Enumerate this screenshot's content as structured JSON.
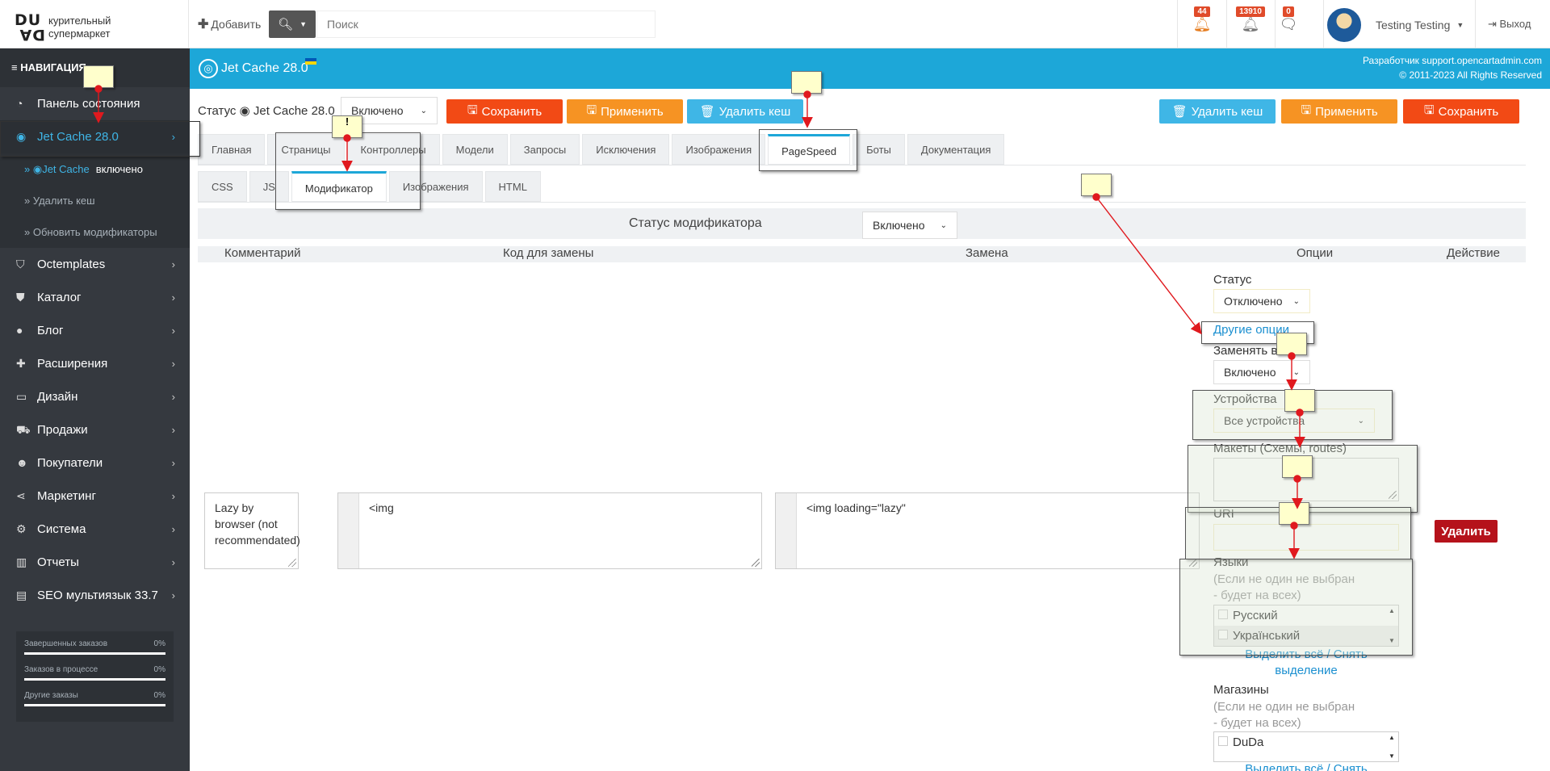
{
  "header": {
    "logo_mark_top": "DU",
    "logo_mark_bottom": "DA",
    "logo_line1": "курительный",
    "logo_line2": "супермаркет",
    "add_label": "Добавить",
    "search_placeholder": "Поиск",
    "notifications": [
      {
        "icon": "bell-icon",
        "count": "44",
        "color": "#e67e22"
      },
      {
        "icon": "bell-icon",
        "count": "13910",
        "color": "#777777"
      },
      {
        "icon": "comment-icon",
        "count": "0",
        "color": "#555555"
      }
    ],
    "user_name": "Testing Testing",
    "exit_label": "Выход"
  },
  "sidebar": {
    "nav_title": "НАВИГАЦИЯ",
    "items": [
      {
        "label": "Панель состояния",
        "icon": "dashboard-icon"
      },
      {
        "label": "Jet Cache 28.0",
        "icon": "target-icon",
        "active": true
      },
      {
        "label": "Octemplates",
        "icon": "shield-icon"
      },
      {
        "label": "Каталог",
        "icon": "tags-icon"
      },
      {
        "label": "Блог",
        "icon": "comment-icon"
      },
      {
        "label": "Расширения",
        "icon": "puzzle-icon"
      },
      {
        "label": "Дизайн",
        "icon": "monitor-icon"
      },
      {
        "label": "Продажи",
        "icon": "cart-icon"
      },
      {
        "label": "Покупатели",
        "icon": "user-icon"
      },
      {
        "label": "Маркетинг",
        "icon": "share-icon"
      },
      {
        "label": "Система",
        "icon": "gear-icon"
      },
      {
        "label": "Отчеты",
        "icon": "bar-chart-icon"
      },
      {
        "label": "SEO мультиязык 33.7",
        "icon": "window-icon"
      }
    ],
    "sub_items": [
      {
        "label": "Jet Cache",
        "extra": "включено"
      },
      {
        "label": "Удалить кеш"
      },
      {
        "label": "Обновить модификаторы"
      }
    ],
    "stats": [
      {
        "label": "Завершенных заказов",
        "value": "0%"
      },
      {
        "label": "Заказов в процессе",
        "value": "0%"
      },
      {
        "label": "Другие заказы",
        "value": "0%"
      }
    ]
  },
  "page": {
    "title": "Jet Cache 28.0",
    "copyright_line1": "Разработчик support.opencartadmin.com",
    "copyright_line2": "© 2011-2023 All Rights Reserved",
    "status_label": "Статус",
    "status_module": "Jet Cache 28.0",
    "status_value": "Включено",
    "buttons": {
      "save": "Сохранить",
      "apply": "Применить",
      "clear_cache": "Удалить кеш"
    },
    "main_tabs": [
      "Главная",
      "Страницы",
      "Контроллеры",
      "Модели",
      "Запросы",
      "Исключения",
      "Изображения",
      "PageSpeed",
      "Боты",
      "Документация"
    ],
    "main_tab_active": "PageSpeed",
    "sub_tabs": [
      "CSS",
      "JS",
      "Модификатор",
      "Изображения",
      "HTML"
    ],
    "sub_tab_active": "Модификатор",
    "modifier_status_label": "Статус модификатора",
    "modifier_status_value": "Включено",
    "columns": [
      "Комментарий",
      "Код для замены",
      "Замена",
      "Опции",
      "Действие"
    ],
    "row": {
      "comment": "Lazy by browser (not recommendated)",
      "code": "<img",
      "replace": "<img loading=\"lazy\"",
      "delete_label": "Удалить"
    },
    "options": {
      "status_label": "Статус",
      "status_value": "Отключено",
      "other_options": "Другие опции",
      "replace_all_label": "Заменять в",
      "replace_all_value": "Включено",
      "devices_label": "Устройства",
      "devices_value": "Все устройства",
      "layouts_label": "Макеты (Схемы, routes)",
      "uri_label": "URI",
      "languages_label": "Языки",
      "languages_hint_1": "(Если не один не выбран",
      "languages_hint_2": "- будет на всех)",
      "languages": [
        "Русский",
        "Український"
      ],
      "select_all_1": "Выделить всё / Снять",
      "select_all_2": "выделение",
      "stores_label": "Магазины",
      "stores_hint_1": "(Если не один не выбран",
      "stores_hint_2": "- будет на всех)",
      "stores": [
        "DuDa"
      ],
      "select_all_stores": "Выделить всё / Снять"
    }
  },
  "annotations": {
    "note_marker": "!"
  },
  "colors": {
    "sidebar_bg": "#35393f",
    "header_bar": "#1da7d8",
    "accent": "#3fb5e6",
    "save": "#f24a15",
    "apply": "#f69323",
    "clear": "#3fb6e6",
    "delete": "#b5121b",
    "arrow": "#e0191e"
  }
}
